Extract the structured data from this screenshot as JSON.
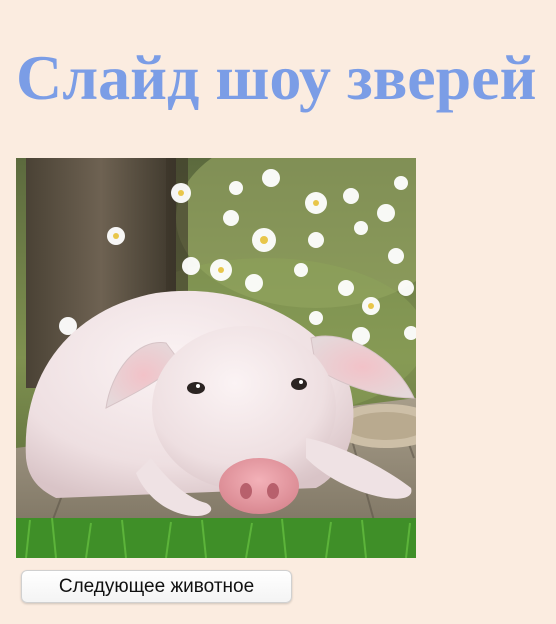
{
  "page": {
    "title": "Слайд шоу зверей",
    "background_color": "#fbece0",
    "title_color": "#7b9de6"
  },
  "slideshow": {
    "current_image": "pig-lying-on-wooden-boards-photo",
    "next_button_label": "Следующее животное"
  }
}
